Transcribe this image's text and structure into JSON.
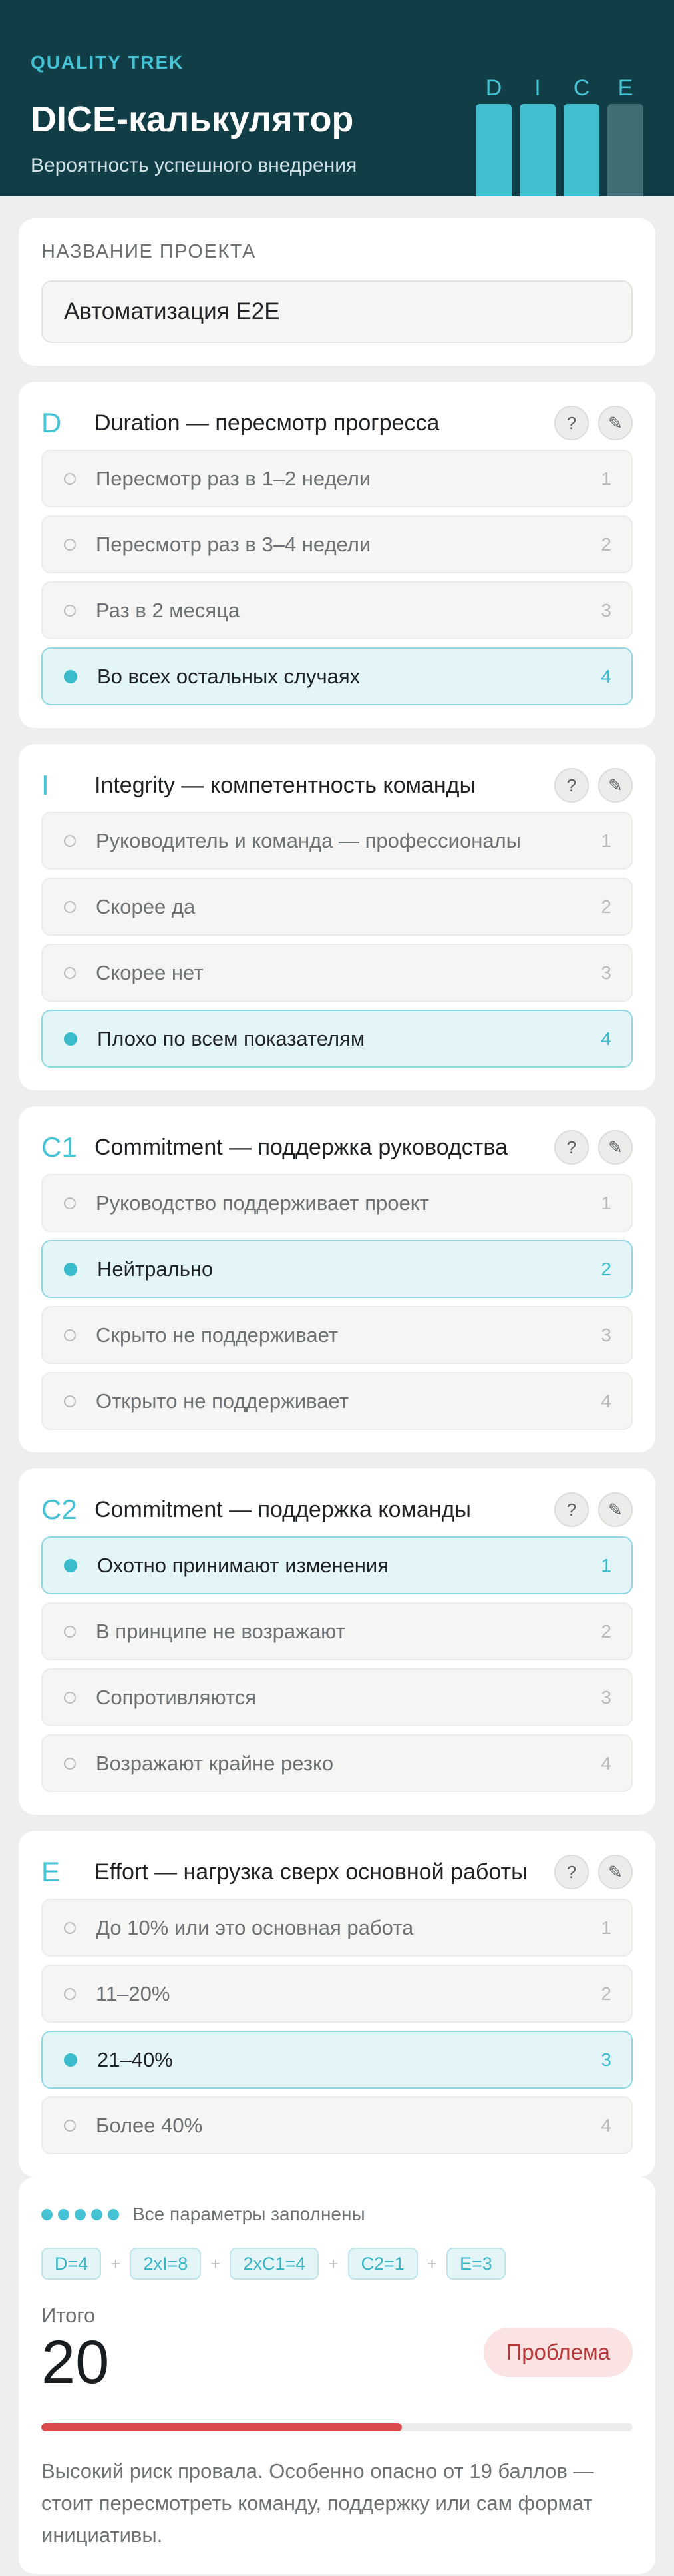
{
  "header": {
    "brand": "QUALITY TREK",
    "title": "DICE-калькулятор",
    "subtitle": "Вероятность успешного внедрения",
    "bars": [
      {
        "letter": "D",
        "state": "filled"
      },
      {
        "letter": "I",
        "state": "filled"
      },
      {
        "letter": "C",
        "state": "filled"
      },
      {
        "letter": "E",
        "state": "muted"
      }
    ]
  },
  "project": {
    "label": "НАЗВАНИЕ ПРОЕКТА",
    "value": "Автоматизация E2E"
  },
  "questions": [
    {
      "code": "D",
      "title": "Duration — пересмотр прогресса",
      "help_icon": "?",
      "edit_icon": "✎",
      "selected": 3,
      "options": [
        {
          "label": "Пересмотр раз в 1–2 недели",
          "score": "1"
        },
        {
          "label": "Пересмотр раз в 3–4 недели",
          "score": "2"
        },
        {
          "label": "Раз в 2 месяца",
          "score": "3"
        },
        {
          "label": "Во всех остальных случаях",
          "score": "4"
        }
      ]
    },
    {
      "code": "I",
      "title": "Integrity — компетентность команды",
      "help_icon": "?",
      "edit_icon": "✎",
      "selected": 3,
      "options": [
        {
          "label": "Руководитель и команда — профессионалы",
          "score": "1"
        },
        {
          "label": "Скорее да",
          "score": "2"
        },
        {
          "label": "Скорее нет",
          "score": "3"
        },
        {
          "label": "Плохо по всем показателям",
          "score": "4"
        }
      ]
    },
    {
      "code": "C1",
      "title": "Commitment — поддержка руководства",
      "help_icon": "?",
      "edit_icon": "✎",
      "selected": 1,
      "options": [
        {
          "label": "Руководство поддерживает проект",
          "score": "1"
        },
        {
          "label": "Нейтрально",
          "score": "2"
        },
        {
          "label": "Скрыто не поддерживает",
          "score": "3"
        },
        {
          "label": "Открыто не поддерживает",
          "score": "4"
        }
      ]
    },
    {
      "code": "C2",
      "title": "Commitment — поддержка команды",
      "help_icon": "?",
      "edit_icon": "✎",
      "selected": 0,
      "options": [
        {
          "label": "Охотно принимают изменения",
          "score": "1"
        },
        {
          "label": "В принципе не возражают",
          "score": "2"
        },
        {
          "label": "Сопротивляются",
          "score": "3"
        },
        {
          "label": "Возражают крайне резко",
          "score": "4"
        }
      ]
    },
    {
      "code": "E",
      "title": "Effort — нагрузка сверх основной работы",
      "help_icon": "?",
      "edit_icon": "✎",
      "selected": 2,
      "options": [
        {
          "label": "До 10% или это основная работа",
          "score": "1"
        },
        {
          "label": "11–20%",
          "score": "2"
        },
        {
          "label": "21–40%",
          "score": "3"
        },
        {
          "label": "Более 40%",
          "score": "4"
        }
      ]
    }
  ],
  "summary": {
    "progress_dots": 5,
    "progress_text": "Все параметры заполнены",
    "chips": [
      "D=4",
      "2xI=8",
      "2xC1=4",
      "C2=1",
      "E=3"
    ],
    "plus": "+",
    "total_label": "Итого",
    "total_value": "20",
    "verdict": "Проблема",
    "risk_fill_fraction": 0.61,
    "message": "Высокий риск провала. Особенно опасно от 19 баллов — стоит пересмотреть команду, поддержку или сам формат инициативы."
  },
  "colors": {
    "accent": "#45c2d3",
    "header_bg": "#113d47",
    "danger": "#dc4b4b",
    "verdict_bg": "#fbe3e3"
  }
}
